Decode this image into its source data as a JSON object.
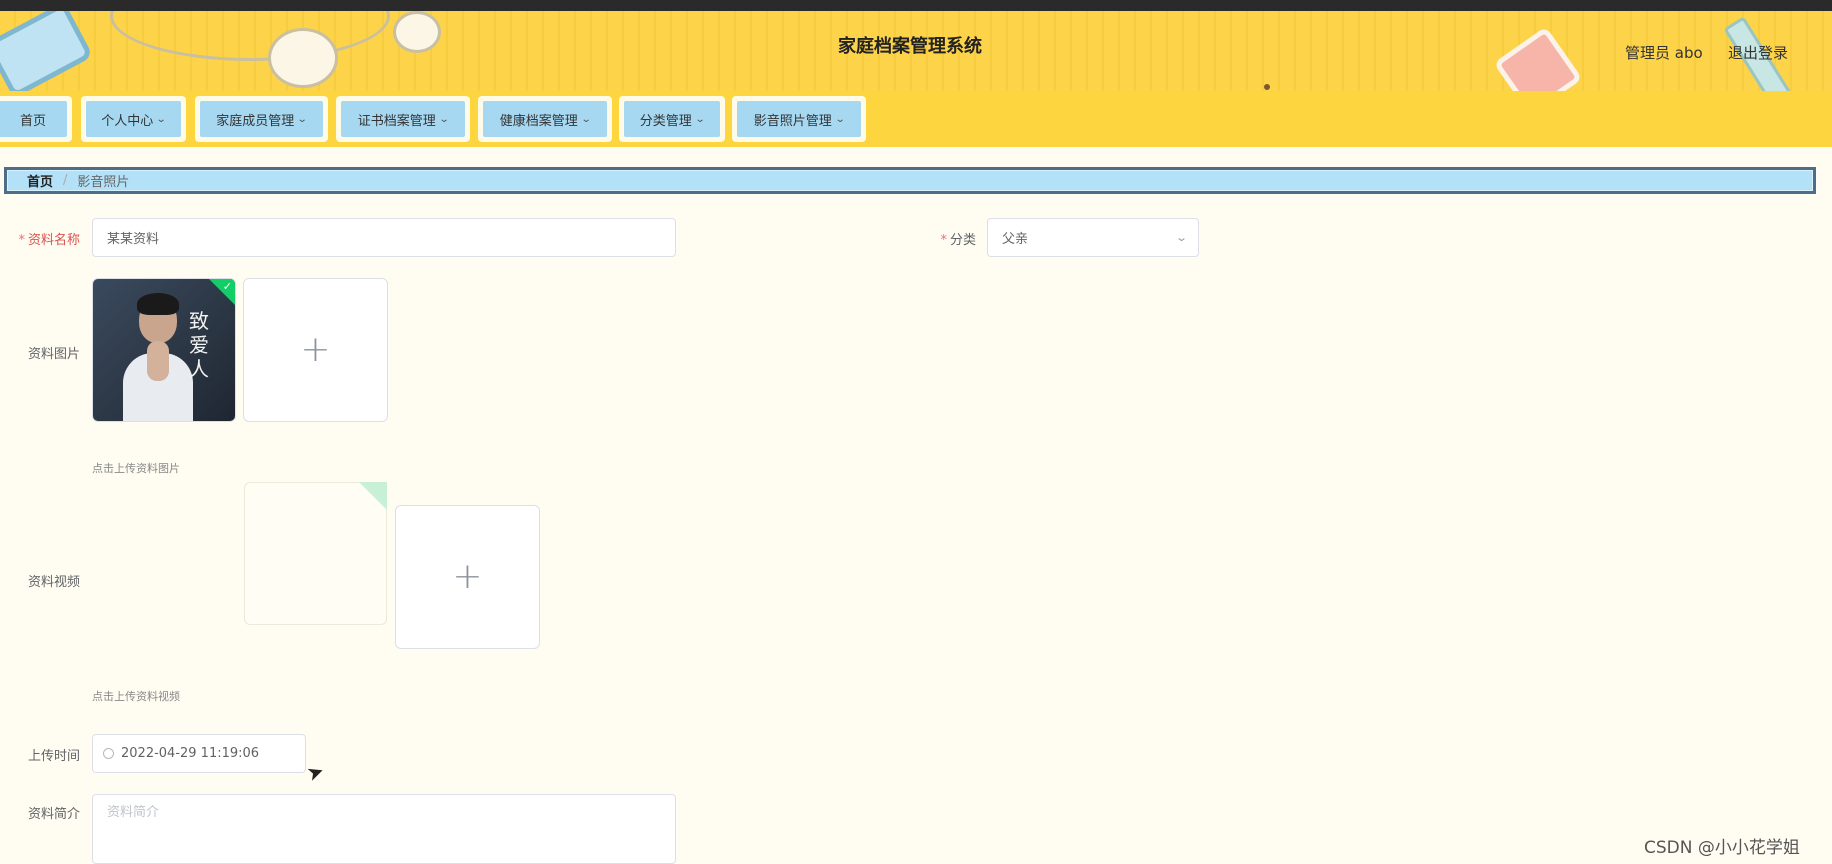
{
  "header": {
    "title": "家庭档案管理系统",
    "admin_label": "管理员 abo",
    "logout_label": "退出登录"
  },
  "nav": {
    "items": [
      {
        "label": "首页",
        "has_dropdown": false
      },
      {
        "label": "个人中心",
        "has_dropdown": true
      },
      {
        "label": "家庭成员管理",
        "has_dropdown": true
      },
      {
        "label": "证书档案管理",
        "has_dropdown": true
      },
      {
        "label": "健康档案管理",
        "has_dropdown": true
      },
      {
        "label": "分类管理",
        "has_dropdown": true
      },
      {
        "label": "影音照片管理",
        "has_dropdown": true
      }
    ]
  },
  "breadcrumb": {
    "home": "首页",
    "separator": "/",
    "current": "影音照片"
  },
  "form": {
    "name_label": "资料名称",
    "name_value": "某某资料",
    "category_label": "分类",
    "category_value": "父亲",
    "image_label": "资料图片",
    "image_thumb_text": "致爱人",
    "image_hint": "点击上传资料图片",
    "video_label": "资料视频",
    "video_hint": "点击上传资料视频",
    "time_label": "上传时间",
    "time_value": "2022-04-29 11:19:06",
    "intro_label": "资料简介",
    "intro_placeholder": "资料简介"
  },
  "icons": {
    "plus": "plus-icon",
    "check": "check-icon",
    "clock": "clock-icon",
    "chevron": "chevron-down-icon"
  },
  "colors": {
    "header_bg": "#fcd349",
    "nav_item_bg": "#a7d8f2",
    "breadcrumb_bg": "#b3e2f8",
    "required_star": "#f56c6c",
    "success_corner": "#13ce66",
    "page_bg": "#fffdf2"
  },
  "watermark": "CSDN @小小花学姐"
}
